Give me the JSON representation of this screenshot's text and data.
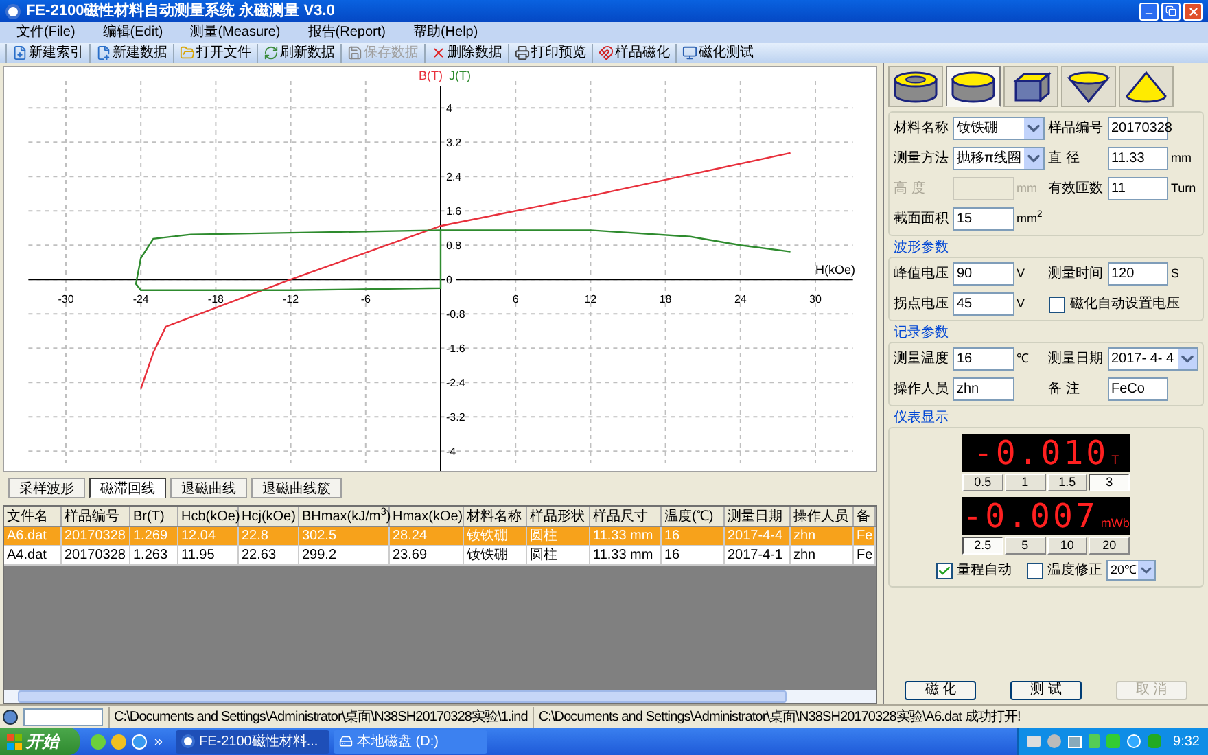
{
  "window": {
    "title": "FE-2100磁性材料自动测量系统 永磁测量 V3.0"
  },
  "menu": [
    "文件(File)",
    "编辑(Edit)",
    "测量(Measure)",
    "报告(Report)",
    "帮助(Help)"
  ],
  "toolbar": [
    {
      "label": "新建索引",
      "kind": "new-index",
      "disabled": false
    },
    {
      "label": "新建数据",
      "kind": "new-data",
      "disabled": false
    },
    {
      "label": "打开文件",
      "kind": "open",
      "disabled": false
    },
    {
      "label": "刷新数据",
      "kind": "refresh",
      "disabled": false
    },
    {
      "label": "保存数据",
      "kind": "save",
      "disabled": true
    },
    {
      "label": "删除数据",
      "kind": "delete",
      "disabled": false
    },
    {
      "label": "打印预览",
      "kind": "print",
      "disabled": false
    },
    {
      "label": "样品磁化",
      "kind": "magnetize",
      "disabled": false
    },
    {
      "label": "磁化测试",
      "kind": "test",
      "disabled": false
    }
  ],
  "chart": {
    "chart_data": {
      "type": "line",
      "xlabel": "H(kOe)",
      "xlim": [
        -33,
        33
      ],
      "ylim": [
        -4.5,
        4.5
      ],
      "grid": true,
      "xticks": [
        -30,
        -24,
        -18,
        -12,
        -6,
        6,
        12,
        18,
        24,
        30
      ],
      "yticks": [
        4,
        3.2,
        2.4,
        1.6,
        0.8,
        0,
        -0.8,
        -1.6,
        -2.4,
        -3.2,
        -4
      ],
      "series": [
        {
          "name": "B(T)",
          "color": "#e8303c",
          "x": [
            -24,
            -23,
            -22,
            -12,
            0,
            12,
            20,
            28
          ],
          "values": [
            -2.55,
            -1.7,
            -1.1,
            0,
            1.25,
            1.95,
            2.45,
            2.95
          ]
        },
        {
          "name": "J(T)",
          "color": "#2e8b2e",
          "x": [
            28,
            24,
            20,
            12,
            0,
            -20,
            -23,
            -24,
            -24.4,
            -24,
            -12,
            0,
            0
          ],
          "values": [
            0.65,
            0.8,
            1.0,
            1.15,
            1.15,
            1.05,
            0.95,
            0.5,
            -0.1,
            -0.25,
            -0.25,
            -0.2,
            1.15
          ]
        }
      ]
    }
  },
  "view_tabs": [
    {
      "label": "采样波形",
      "selected": false
    },
    {
      "label": "磁滞回线",
      "selected": true
    },
    {
      "label": "退磁曲线",
      "selected": false
    },
    {
      "label": "退磁曲线簇",
      "selected": false
    }
  ],
  "table": {
    "columns": [
      "文件名",
      "样品编号",
      "Br(T)",
      "Hcb(kOe)",
      "Hcj(kOe)",
      "BHmax(kJ/m$^{3}$)",
      "Hmax(kOe)",
      "材料名称",
      "样品形状",
      "样品尺寸",
      "温度(℃)",
      "测量日期",
      "操作人员",
      "备"
    ],
    "rows": [
      {
        "selected": true,
        "cells": [
          "A6.dat",
          "20170328",
          "1.269",
          "12.04",
          "22.8",
          "302.5",
          "28.24",
          "钕铁硼",
          "圆柱",
          "11.33 mm",
          "16",
          "2017-4-4",
          "zhn",
          "Fe"
        ]
      },
      {
        "selected": false,
        "cells": [
          "A4.dat",
          "20170328",
          "1.263",
          "11.95",
          "22.63",
          "299.2",
          "23.69",
          "钕铁硼",
          "圆柱",
          "11.33 mm",
          "16",
          "2017-4-1",
          "zhn",
          "Fe"
        ]
      }
    ]
  },
  "shape_tabs": [
    {
      "kind": "ring",
      "selected": false
    },
    {
      "kind": "cylinder",
      "selected": true
    },
    {
      "kind": "cube",
      "selected": false
    },
    {
      "kind": "inverted-cone",
      "selected": false
    },
    {
      "kind": "cone",
      "selected": false
    }
  ],
  "sample_fields": [
    {
      "label": "材料名称",
      "kind": "select",
      "value": "钕铁硼"
    },
    {
      "label": "样品编号",
      "kind": "input",
      "value": "20170328",
      "disabled": false
    },
    {
      "label": "测量方法",
      "kind": "select",
      "value": "抛移π线圈"
    },
    {
      "label": "直 径",
      "kind": "input",
      "value": "11.33",
      "unit": "mm",
      "disabled": false
    },
    {
      "label": "高 度",
      "kind": "input",
      "unit": "mm",
      "disabled": true
    },
    {
      "label": "有效匝数",
      "kind": "input",
      "value": "11",
      "unit": "Turn",
      "disabled": false
    },
    {
      "label": "截面面积",
      "kind": "input",
      "value": "15",
      "unit": "mm$^{2}$",
      "disabled": false
    }
  ],
  "waveform": {
    "title": "波形参数",
    "fields": [
      {
        "label": "峰值电压",
        "kind": "input",
        "value": "90",
        "unit": "V",
        "disabled": false
      },
      {
        "label": "测量时间",
        "kind": "input",
        "value": "120",
        "unit": "S",
        "disabled": false
      },
      {
        "label": "拐点电压",
        "kind": "input",
        "value": "45",
        "unit": "V",
        "disabled": false
      },
      {
        "label": "磁化自动设置电压",
        "kind": "check",
        "checked": false
      }
    ]
  },
  "record": {
    "title": "记录参数",
    "fields": [
      {
        "label": "测量温度",
        "kind": "input",
        "value": "16",
        "unit": "℃",
        "disabled": false
      },
      {
        "label": "测量日期",
        "kind": "select",
        "value": "2017- 4- 4"
      },
      {
        "label": "操作人员",
        "kind": "input",
        "value": "zhn",
        "disabled": false
      },
      {
        "label": "备 注",
        "kind": "input",
        "value": "FeCo",
        "disabled": false
      }
    ]
  },
  "meters": {
    "title": "仪表显示",
    "displays": [
      {
        "reading": "-0.010",
        "unit": "T",
        "ranges": [
          {
            "label": "0.5",
            "selected": false
          },
          {
            "label": "1",
            "selected": false
          },
          {
            "label": "1.5",
            "selected": false
          },
          {
            "label": "3",
            "selected": true
          }
        ]
      },
      {
        "reading": "-0.007",
        "unit": "mWb",
        "ranges": [
          {
            "label": "2.5",
            "selected": true
          },
          {
            "label": "5",
            "selected": false
          },
          {
            "label": "10",
            "selected": false
          },
          {
            "label": "20",
            "selected": false
          }
        ]
      }
    ],
    "auto_range": {
      "label": "量程自动",
      "checked": true
    },
    "temp_correction": {
      "label": "温度修正",
      "checked": false,
      "value": "20℃"
    }
  },
  "actions": [
    {
      "label": "磁 化",
      "disabled": false
    },
    {
      "label": "测 试",
      "disabled": false
    },
    {
      "label": "取 消",
      "disabled": true
    }
  ],
  "status_bar": [
    "C:\\Documents and Settings\\Administrator\\桌面\\N38SH20170328实验\\1.ind",
    "C:\\Documents and Settings\\Administrator\\桌面\\N38SH20170328实验\\A6.dat 成功打开!"
  ],
  "taskbar": {
    "start": "开始",
    "tasks": [
      {
        "label": "FE-2100磁性材料...",
        "selected": true
      },
      {
        "label": "本地磁盘 (D:)",
        "selected": false
      }
    ],
    "clock": "9:32"
  }
}
